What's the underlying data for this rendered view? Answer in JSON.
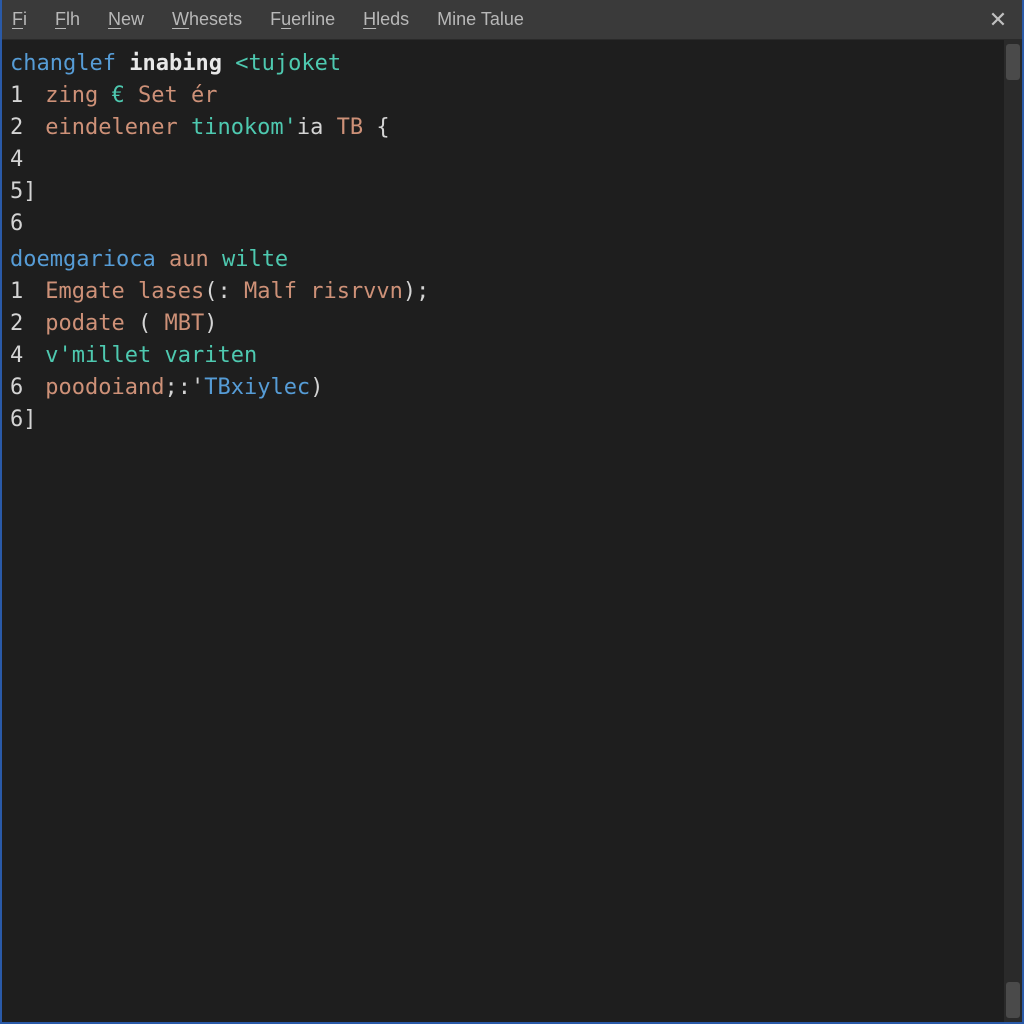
{
  "menubar": {
    "items": [
      {
        "label": "Fi",
        "underline_index": 0
      },
      {
        "label": "Flh",
        "underline_index": 0
      },
      {
        "label": "New",
        "underline_index": 0
      },
      {
        "label": "Whesets",
        "underline_index": 0
      },
      {
        "label": "Fuerline",
        "underline_index": 1
      },
      {
        "label": "Hleds",
        "underline_index": 0
      },
      {
        "label": "Mine Talue",
        "underline_index": -1
      }
    ],
    "close_glyph": "✕"
  },
  "editor": {
    "blocks": [
      {
        "header_tokens": [
          {
            "t": "changlef",
            "c": "tok-kw"
          },
          {
            "t": " ",
            "c": ""
          },
          {
            "t": "inabing",
            "c": "tok-white"
          },
          {
            "t": " ",
            "c": ""
          },
          {
            "t": "<",
            "c": "tok-fn"
          },
          {
            "t": "tujoket",
            "c": "tok-fn"
          }
        ],
        "lines": [
          {
            "num": "1",
            "tokens": [
              {
                "t": "zing",
                "c": "tok-type"
              },
              {
                "t": " ",
                "c": ""
              },
              {
                "t": "€",
                "c": "tok-fn"
              },
              {
                "t": " ",
                "c": ""
              },
              {
                "t": "Set",
                "c": "tok-type"
              },
              {
                "t": " ",
                "c": ""
              },
              {
                "t": "ér",
                "c": "tok-type"
              }
            ]
          },
          {
            "num": "2",
            "tokens": [
              {
                "t": "eindelener",
                "c": "tok-type"
              },
              {
                "t": " ",
                "c": ""
              },
              {
                "t": "tinokom'",
                "c": "tok-fn"
              },
              {
                "t": "ia",
                "c": "tok-plain"
              },
              {
                "t": " ",
                "c": ""
              },
              {
                "t": "TB",
                "c": "tok-type"
              },
              {
                "t": " ",
                "c": ""
              },
              {
                "t": "{",
                "c": "tok-brace"
              }
            ]
          },
          {
            "num": "4",
            "tokens": []
          },
          {
            "num": "5]",
            "tokens": []
          },
          {
            "num": "6",
            "tokens": []
          }
        ]
      },
      {
        "header_tokens": [
          {
            "t": "doemgarioca",
            "c": "tok-kw"
          },
          {
            "t": " ",
            "c": ""
          },
          {
            "t": "aun",
            "c": "tok-type"
          },
          {
            "t": " ",
            "c": ""
          },
          {
            "t": "wilte",
            "c": "tok-fn"
          }
        ],
        "lines": [
          {
            "num": "1",
            "tokens": [
              {
                "t": "Emgate",
                "c": "tok-type"
              },
              {
                "t": " ",
                "c": ""
              },
              {
                "t": "lases",
                "c": "tok-type"
              },
              {
                "t": "(: ",
                "c": "tok-plain"
              },
              {
                "t": "Malf",
                "c": "tok-type"
              },
              {
                "t": " ",
                "c": ""
              },
              {
                "t": "risrvvn",
                "c": "tok-type"
              },
              {
                "t": ");",
                "c": "tok-plain"
              }
            ]
          },
          {
            "num": "2",
            "tokens": [
              {
                "t": "podate",
                "c": "tok-type"
              },
              {
                "t": " ( ",
                "c": "tok-plain"
              },
              {
                "t": "MBT",
                "c": "tok-type"
              },
              {
                "t": ")",
                "c": "tok-plain"
              }
            ]
          },
          {
            "num": "4",
            "tokens": [
              {
                "t": "v'millet",
                "c": "tok-fn"
              },
              {
                "t": " ",
                "c": ""
              },
              {
                "t": "variten",
                "c": "tok-fn"
              }
            ]
          },
          {
            "num": "6",
            "tokens": [
              {
                "t": "poodoiand",
                "c": "tok-type"
              },
              {
                "t": ";:'",
                "c": "tok-plain"
              },
              {
                "t": "TBxiylec",
                "c": "tok-kw"
              },
              {
                "t": ")",
                "c": "tok-plain"
              }
            ]
          },
          {
            "num": "6]",
            "tokens": []
          }
        ]
      }
    ]
  }
}
